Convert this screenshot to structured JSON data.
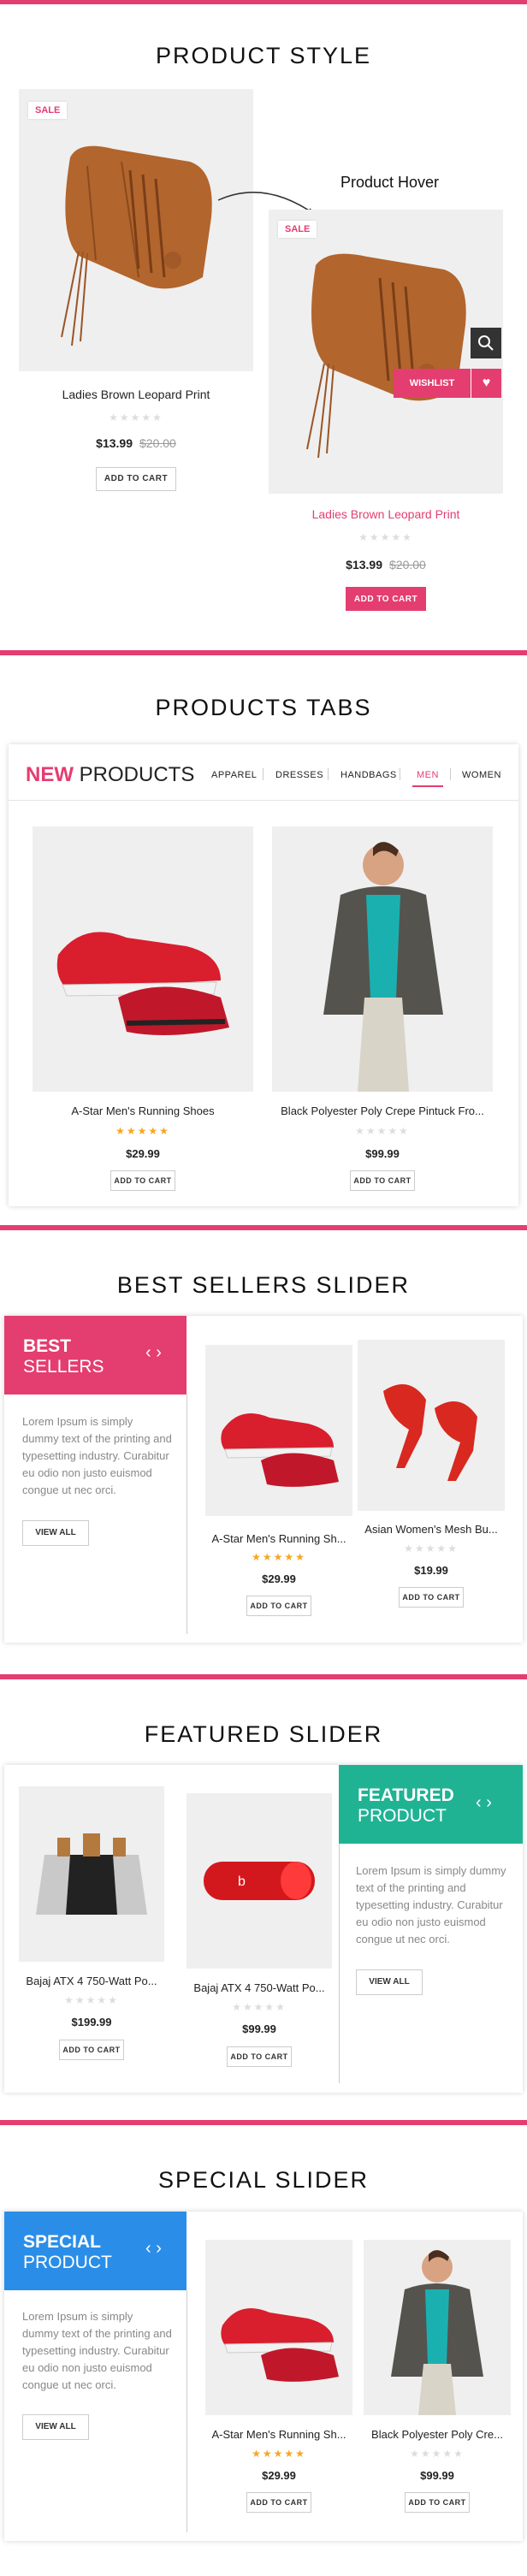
{
  "sections": {
    "product_style": "PRODUCT STYLE",
    "products_tabs": "PRODUCTS TABS",
    "best_sellers": "BEST SELLERS SLIDER",
    "featured": "FEATURED SLIDER",
    "special": "SPECIAL SLIDER"
  },
  "style_demo": {
    "sale": "SALE",
    "hover_label": "Product Hover",
    "normal": {
      "name": "Ladies Brown Leopard Print",
      "stars": "★★★★★",
      "price": "$13.99",
      "old_price": "$20.00",
      "button": "ADD TO CART"
    },
    "hover": {
      "name": "Ladies Brown Leopard Print",
      "stars": "★★★★★",
      "price": "$13.99",
      "old_price": "$20.00",
      "button": "ADD TO CART",
      "wishlist": "WISHLIST"
    }
  },
  "tabs": {
    "heading_bold": "NEW",
    "heading_rest": "PRODUCTS",
    "items": [
      "APPAREL",
      "DRESSES",
      "HANDBAGS",
      "MEN",
      "WOMEN"
    ],
    "active": "MEN",
    "products": [
      {
        "name": "A-Star Men's Running Shoes",
        "stars": "★★★★★",
        "price": "$29.99",
        "button": "ADD TO CART"
      },
      {
        "name": "Black Polyester Poly Crepe Pintuck Fro...",
        "stars": "★★★★★",
        "price": "$99.99",
        "button": "ADD TO CART"
      }
    ]
  },
  "best": {
    "head1": "BEST",
    "head2": "SELLERS",
    "color": "#e43d70",
    "text": "Lorem Ipsum is simply dummy text of the printing and typesetting industry. Curabitur eu odio non justo euismod congue ut nec orci.",
    "view_all": "VIEW ALL",
    "products": [
      {
        "name": "A-Star Men's Running Sh...",
        "stars": "★★★★★",
        "price": "$29.99",
        "button": "ADD TO CART"
      },
      {
        "name": "Asian Women's Mesh Bu...",
        "stars": "★★★★★",
        "price": "$19.99",
        "button": "ADD TO CART"
      }
    ]
  },
  "featured": {
    "head1": "FEATURED",
    "head2": "PRODUCT",
    "color": "#1fb394",
    "text": "Lorem Ipsum is simply dummy text of the printing and typesetting industry. Curabitur eu odio non justo euismod congue ut nec orci.",
    "view_all": "VIEW ALL",
    "products": [
      {
        "name": "Bajaj ATX 4 750-Watt Po...",
        "stars": "★★★★★",
        "price": "$199.99",
        "button": "ADD TO CART"
      },
      {
        "name": "Bajaj ATX 4 750-Watt Po...",
        "stars": "★★★★★",
        "price": "$99.99",
        "button": "ADD TO CART"
      }
    ]
  },
  "special": {
    "head1": "SPECIAL",
    "head2": "PRODUCT",
    "color": "#2a8ee8",
    "text": "Lorem Ipsum is simply dummy text of the printing and typesetting industry. Curabitur eu odio non justo euismod congue ut nec orci.",
    "view_all": "VIEW ALL",
    "products": [
      {
        "name": "A-Star Men's Running Sh...",
        "stars": "★★★★★",
        "price": "$29.99",
        "button": "ADD TO CART"
      },
      {
        "name": "Black Polyester Poly Cre...",
        "stars": "★★★★★",
        "price": "$99.99",
        "button": "ADD TO CART"
      }
    ]
  },
  "arrows": "‹ ›",
  "icons": {
    "search": "search-icon",
    "wishlist": "heart-icon"
  }
}
